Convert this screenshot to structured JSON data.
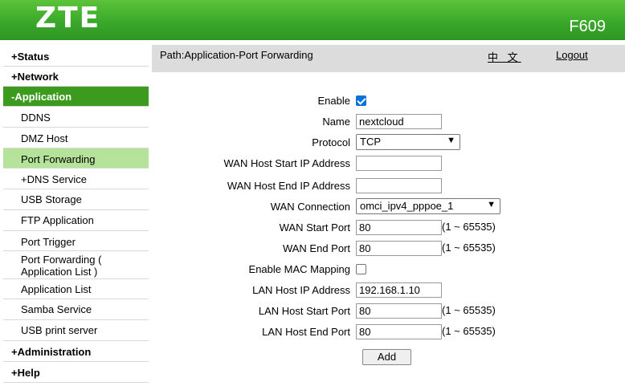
{
  "header": {
    "brand": "ZTE",
    "model": "F609"
  },
  "sidebar": {
    "items": [
      {
        "marker": "+",
        "label": "Status"
      },
      {
        "marker": "+",
        "label": "Network"
      },
      {
        "marker": "-",
        "label": "Application"
      },
      {
        "label": "DDNS"
      },
      {
        "label": "DMZ Host"
      },
      {
        "label": "Port Forwarding"
      },
      {
        "marker": "+",
        "label": "DNS Service"
      },
      {
        "label": "USB Storage"
      },
      {
        "label": "FTP Application"
      },
      {
        "label": "Port Trigger"
      },
      {
        "label_line1": "Port Forwarding (",
        "label_line2": "Application List )"
      },
      {
        "label": "Application List"
      },
      {
        "label": "Samba Service"
      },
      {
        "label": "USB print server"
      },
      {
        "marker": "+",
        "label": "Administration"
      },
      {
        "marker": "+",
        "label": "Help"
      }
    ]
  },
  "pathbar": {
    "path": "Path:Application-Port Forwarding",
    "language": "中 文",
    "logout": "Logout"
  },
  "form": {
    "enable": {
      "label": "Enable",
      "checked": true
    },
    "name": {
      "label": "Name",
      "value": "nextcloud"
    },
    "protocol": {
      "label": "Protocol",
      "value": "TCP"
    },
    "wan_host_start_ip": {
      "label": "WAN Host Start IP Address",
      "value": ""
    },
    "wan_host_end_ip": {
      "label": "WAN Host End IP Address",
      "value": ""
    },
    "wan_connection": {
      "label": "WAN Connection",
      "value": "omci_ipv4_pppoe_1"
    },
    "wan_start_port": {
      "label": "WAN Start Port",
      "value": "80",
      "range": "(1 ~ 65535)"
    },
    "wan_end_port": {
      "label": "WAN End Port",
      "value": "80",
      "range": "(1 ~ 65535)"
    },
    "mac_mapping": {
      "label": "Enable MAC Mapping",
      "checked": false
    },
    "lan_host_ip": {
      "label": "LAN Host IP Address",
      "value": "192.168.1.10"
    },
    "lan_host_start_port": {
      "label": "LAN Host Start Port",
      "value": "80",
      "range": "(1 ~ 65535)"
    },
    "lan_host_end_port": {
      "label": "LAN Host End Port",
      "value": "80",
      "range": "(1 ~ 65535)"
    },
    "add_label": "Add"
  }
}
